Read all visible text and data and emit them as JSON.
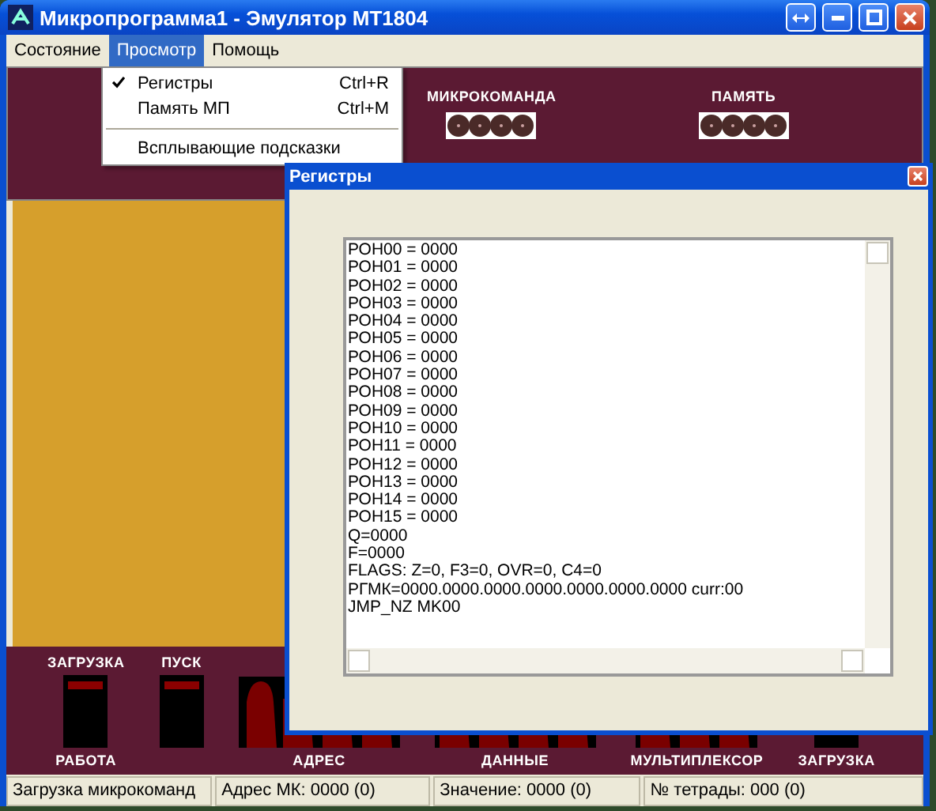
{
  "window": {
    "title": "Микропрограмма1 - Эмулятор МТ1804"
  },
  "menu": [
    {
      "label": "Состояние",
      "selected": false
    },
    {
      "label": "Просмотр",
      "selected": true
    },
    {
      "label": "Помощь",
      "selected": false
    }
  ],
  "dropdown": [
    {
      "kind": "item",
      "label": "Регистры",
      "shortcut": "Ctrl+R",
      "checked": true
    },
    {
      "kind": "item",
      "label": "Память МП",
      "shortcut": "Ctrl+M",
      "checked": false
    },
    {
      "kind": "separator"
    },
    {
      "kind": "item",
      "label": "Всплывающие подсказки",
      "checked": false
    }
  ],
  "top_indicators": [
    {
      "label": "МИКРОКОМАНДА"
    },
    {
      "label": "ПАМЯТЬ"
    }
  ],
  "bottom_controls": [
    {
      "kind": "switch",
      "label": "ЗАГРУЗКА",
      "caption": "РАБОТА",
      "on": true
    },
    {
      "kind": "switch",
      "label": "ПУСК",
      "on": true
    },
    {
      "kind": "display",
      "caption": "АДРЕС"
    },
    {
      "kind": "display",
      "caption": "ДАННЫЕ"
    },
    {
      "kind": "display",
      "caption": "МУЛЬТИПЛЕКСОР"
    },
    {
      "kind": "block",
      "caption": "ЗАГРУЗКА"
    }
  ],
  "dialog": {
    "title": "Регистры",
    "lines": [
      "РОН00 = 0000",
      "РОН01 = 0000",
      "РОН02 = 0000",
      "РОН03 = 0000",
      "РОН04 = 0000",
      "РОН05 = 0000",
      "РОН06 = 0000",
      "РОН07 = 0000",
      "РОН08 = 0000",
      "РОН09 = 0000",
      "РОН10 = 0000",
      "РОН11 = 0000",
      "РОН12 = 0000",
      "РОН13 = 0000",
      "РОН14 = 0000",
      "РОН15 = 0000",
      "Q=0000",
      "F=0000",
      "FLAGS: Z=0, F3=0, OVR=0, C4=0",
      "РГМК=0000.0000.0000.0000.0000.0000.0000 curr:00",
      "JMP_NZ MK00"
    ]
  },
  "status_bar": [
    "Загрузка микрокоманд",
    "Адрес МК: 0000 (0)",
    "Значение: 0000 (0)",
    "№ тетрады: 000 (0)"
  ]
}
